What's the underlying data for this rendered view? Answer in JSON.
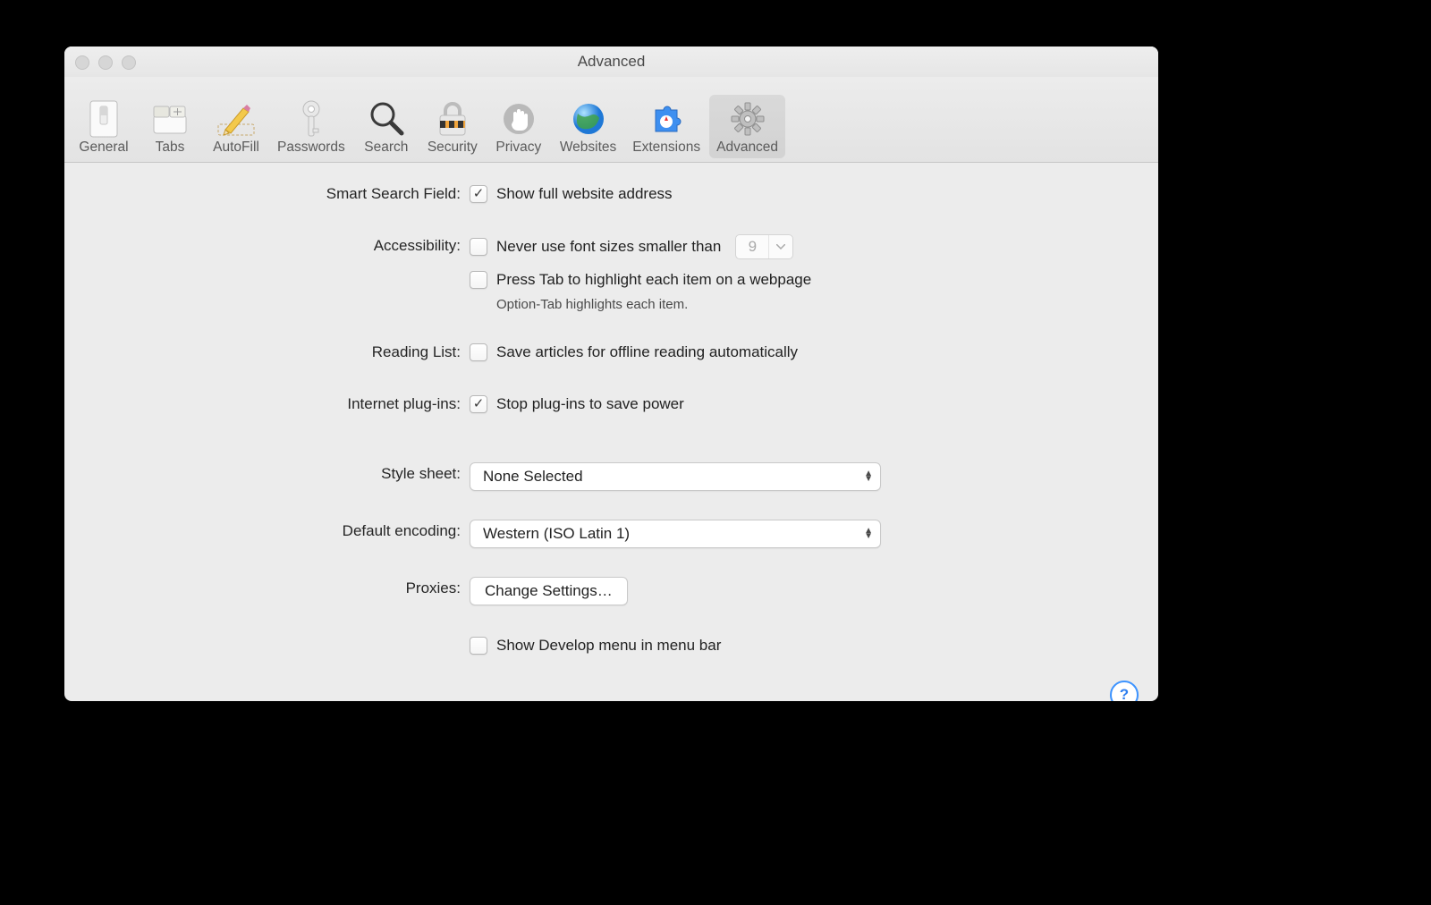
{
  "window": {
    "title": "Advanced"
  },
  "toolbar": {
    "items": [
      {
        "id": "general",
        "label": "General"
      },
      {
        "id": "tabs",
        "label": "Tabs"
      },
      {
        "id": "autofill",
        "label": "AutoFill"
      },
      {
        "id": "passwords",
        "label": "Passwords"
      },
      {
        "id": "search",
        "label": "Search"
      },
      {
        "id": "security",
        "label": "Security"
      },
      {
        "id": "privacy",
        "label": "Privacy"
      },
      {
        "id": "websites",
        "label": "Websites"
      },
      {
        "id": "extensions",
        "label": "Extensions"
      },
      {
        "id": "advanced",
        "label": "Advanced",
        "selected": true
      }
    ]
  },
  "sections": {
    "smart_search": {
      "label": "Smart Search Field:",
      "show_full_address": {
        "checked": true,
        "label": "Show full website address"
      }
    },
    "accessibility": {
      "label": "Accessibility:",
      "min_font": {
        "checked": false,
        "label": "Never use font sizes smaller than",
        "value": "9"
      },
      "tab_highlight": {
        "checked": false,
        "label": "Press Tab to highlight each item on a webpage"
      },
      "tab_note": "Option-Tab highlights each item."
    },
    "reading_list": {
      "label": "Reading List:",
      "save_offline": {
        "checked": false,
        "label": "Save articles for offline reading automatically"
      }
    },
    "plugins": {
      "label": "Internet plug-ins:",
      "stop_plugins": {
        "checked": true,
        "label": "Stop plug-ins to save power"
      }
    },
    "stylesheet": {
      "label": "Style sheet:",
      "value": "None Selected"
    },
    "encoding": {
      "label": "Default encoding:",
      "value": "Western (ISO Latin 1)"
    },
    "proxies": {
      "label": "Proxies:",
      "button": "Change Settings…"
    },
    "develop": {
      "checked": false,
      "label": "Show Develop menu in menu bar"
    }
  },
  "help": "?"
}
